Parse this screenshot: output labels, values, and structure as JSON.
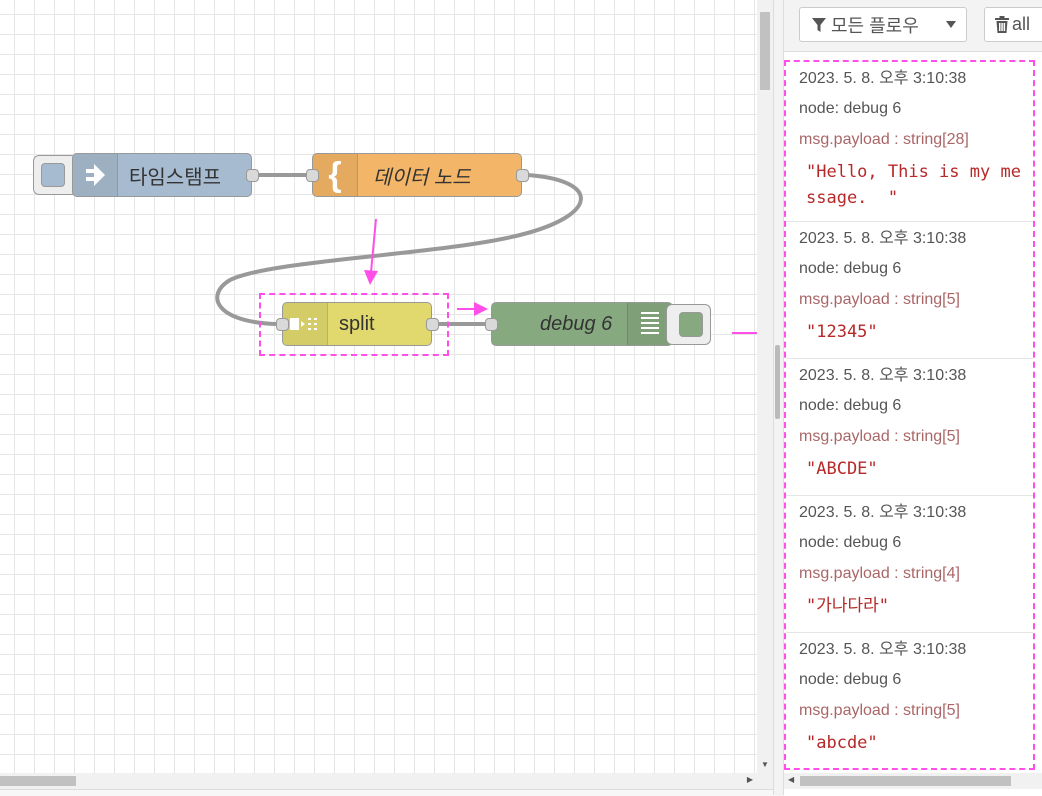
{
  "colors": {
    "inject": "#a6bbcf",
    "template": "#f3b567",
    "split": "#e2d96e",
    "debug": "#87a980",
    "selection": "#ff4fe8",
    "wire": "#999999"
  },
  "nodes": {
    "inject": {
      "label": "타임스탬프",
      "icon": "arrow-right-icon"
    },
    "template": {
      "label": "데이터 노드",
      "icon": "curly-brace-icon"
    },
    "split": {
      "label": "split",
      "icon": "split-icon"
    },
    "debug": {
      "label": "debug 6",
      "icon": "list-lines-icon"
    }
  },
  "sidebar": {
    "filter_label": "모든 플로우",
    "clear_label": "all",
    "messages": [
      {
        "time": "2023. 5. 8. 오후 3:10:38",
        "node": "node: debug 6",
        "meta": "msg.payload : string[28]",
        "payload": "\"Hello, This is my message.  \""
      },
      {
        "time": "2023. 5. 8. 오후 3:10:38",
        "node": "node: debug 6",
        "meta": "msg.payload : string[5]",
        "payload": "\"12345\""
      },
      {
        "time": "2023. 5. 8. 오후 3:10:38",
        "node": "node: debug 6",
        "meta": "msg.payload : string[5]",
        "payload": "\"ABCDE\""
      },
      {
        "time": "2023. 5. 8. 오후 3:10:38",
        "node": "node: debug 6",
        "meta": "msg.payload : string[4]",
        "payload": "\"가나다라\""
      },
      {
        "time": "2023. 5. 8. 오후 3:10:38",
        "node": "node: debug 6",
        "meta": "msg.payload : string[5]",
        "payload": "\"abcde\""
      }
    ]
  }
}
